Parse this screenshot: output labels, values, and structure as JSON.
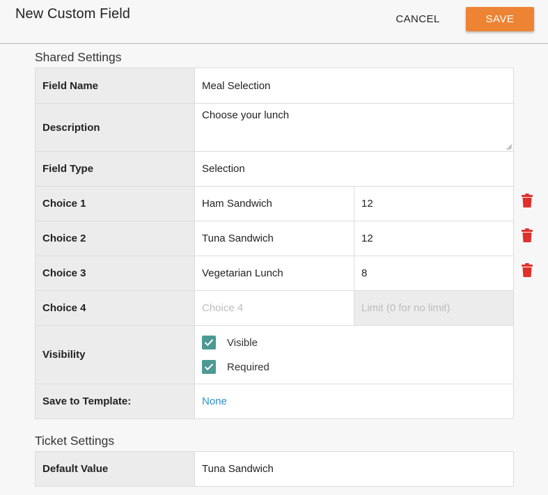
{
  "header": {
    "title": "New Custom Field",
    "cancel_label": "CANCEL",
    "save_label": "SAVE"
  },
  "shared": {
    "section_title": "Shared Settings",
    "field_name": {
      "label": "Field Name",
      "value": "Meal Selection"
    },
    "description": {
      "label": "Description",
      "value": "Choose your lunch"
    },
    "field_type": {
      "label": "Field Type",
      "value": "Selection"
    },
    "choices": [
      {
        "label": "Choice 1",
        "name": "Ham Sandwich",
        "limit": "12",
        "deletable": true
      },
      {
        "label": "Choice 2",
        "name": "Tuna Sandwich",
        "limit": "12",
        "deletable": true
      },
      {
        "label": "Choice 3",
        "name": "Vegetarian Lunch",
        "limit": "8",
        "deletable": true
      },
      {
        "label": "Choice 4",
        "name_placeholder": "Choice 4",
        "limit_placeholder": "Limit (0 for no limit)",
        "deletable": false
      }
    ],
    "visibility": {
      "label": "Visibility",
      "visible": {
        "label": "Visible",
        "checked": true
      },
      "required": {
        "label": "Required",
        "checked": true
      }
    },
    "save_to_template": {
      "label": "Save to Template:",
      "value": "None"
    }
  },
  "ticket": {
    "section_title": "Ticket Settings",
    "default_value": {
      "label": "Default Value",
      "value": "Tuna Sandwich"
    }
  },
  "colors": {
    "accent": "#ec8434",
    "checkbox": "#4c9a93",
    "link": "#2e8fd4",
    "delete": "#e0302a"
  },
  "icons": {
    "delete": "trash-icon",
    "check": "checkmark-icon",
    "resize": "resize-handle-icon"
  }
}
